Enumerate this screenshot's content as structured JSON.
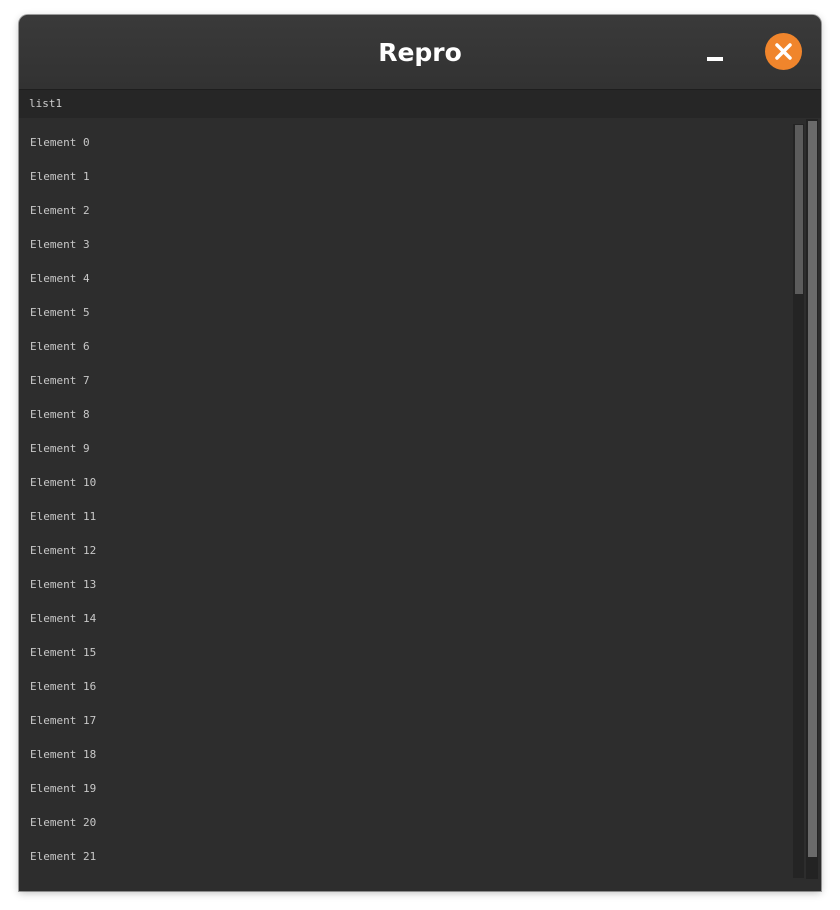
{
  "window": {
    "title": "Repro",
    "controls": {
      "minimize_icon": "minimize-icon",
      "close_icon": "close-icon",
      "close_color": "#f0852c"
    }
  },
  "list": {
    "header": "list1",
    "items": [
      "Element 0",
      "Element 1",
      "Element 2",
      "Element 3",
      "Element 4",
      "Element 5",
      "Element 6",
      "Element 7",
      "Element 8",
      "Element 9",
      "Element 10",
      "Element 11",
      "Element 12",
      "Element 13",
      "Element 14",
      "Element 15",
      "Element 16",
      "Element 17",
      "Element 18",
      "Element 19",
      "Element 20",
      "Element 21"
    ]
  },
  "colors": {
    "background": "#2d2d2d",
    "titlebar": "#363636",
    "text": "#c8c8c8"
  }
}
